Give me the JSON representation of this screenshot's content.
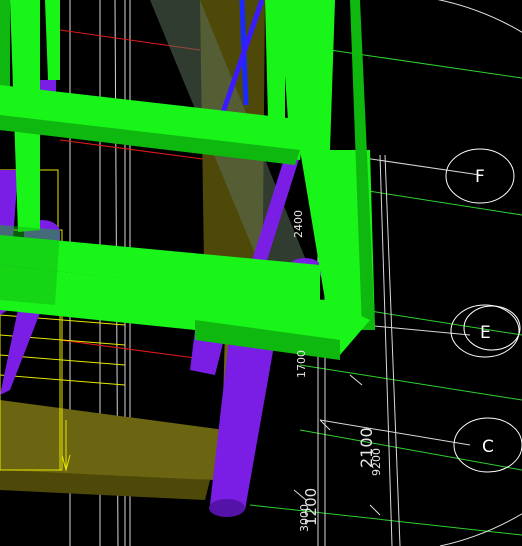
{
  "viewport": {
    "background": "#000000",
    "colors": {
      "beam_green": "#19f419",
      "beam_green_dark": "#0fb80f",
      "column_purple": "#7a1ee6",
      "column_purple_dark": "#5512a8",
      "slab_olive": "#6b6410",
      "slab_olive_dark": "#4e4908",
      "grid_line": "#2fd12f",
      "ref_line_red": "#e01a1a",
      "ref_line_blue": "#1a2aff",
      "stair_yellow": "#e6e600",
      "wire_white": "#ffffff"
    },
    "grid_bubbles": [
      {
        "id": "F",
        "label": "F"
      },
      {
        "id": "E",
        "label": "E"
      },
      {
        "id": "C",
        "label": "C"
      }
    ],
    "dimensions": {
      "d2400": "2400",
      "d1700": "1700",
      "d2100": "2100",
      "d9200": "9200",
      "d1200": "1200",
      "d3000": "3000"
    }
  }
}
